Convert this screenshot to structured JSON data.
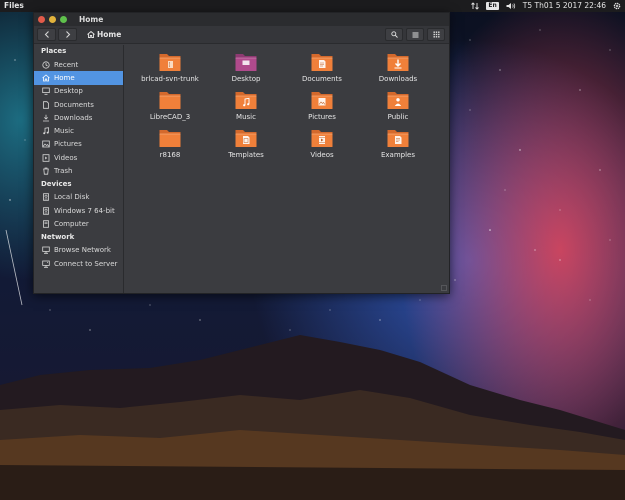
{
  "top_panel": {
    "app_name": "Files",
    "keyboard_layout": "En",
    "clock": "T5 Th01  5 2017 22:46"
  },
  "window": {
    "title": "Home",
    "path_label": "Home"
  },
  "sidebar": {
    "places_header": "Places",
    "places": [
      {
        "label": "Recent",
        "icon": "clock-icon"
      },
      {
        "label": "Home",
        "icon": "home-icon",
        "active": true
      },
      {
        "label": "Desktop",
        "icon": "desktop-icon"
      },
      {
        "label": "Documents",
        "icon": "document-icon"
      },
      {
        "label": "Downloads",
        "icon": "download-icon"
      },
      {
        "label": "Music",
        "icon": "music-icon"
      },
      {
        "label": "Pictures",
        "icon": "picture-icon"
      },
      {
        "label": "Videos",
        "icon": "video-icon"
      },
      {
        "label": "Trash",
        "icon": "trash-icon"
      }
    ],
    "devices_header": "Devices",
    "devices": [
      {
        "label": "Local Disk",
        "icon": "disk-icon"
      },
      {
        "label": "Windows 7 64-bit",
        "icon": "disk-icon"
      },
      {
        "label": "Computer",
        "icon": "computer-icon"
      }
    ],
    "network_header": "Network",
    "network": [
      {
        "label": "Browse Network",
        "icon": "network-icon"
      },
      {
        "label": "Connect to Server",
        "icon": "server-icon"
      }
    ]
  },
  "files": [
    {
      "label": "brlcad-svn-trunk",
      "icon": "folder-archive-icon"
    },
    {
      "label": "Desktop",
      "icon": "folder-desktop-icon"
    },
    {
      "label": "Documents",
      "icon": "folder-documents-icon"
    },
    {
      "label": "Downloads",
      "icon": "folder-downloads-icon"
    },
    {
      "label": "LibreCAD_3",
      "icon": "folder-icon"
    },
    {
      "label": "Music",
      "icon": "folder-music-icon"
    },
    {
      "label": "Pictures",
      "icon": "folder-pictures-icon"
    },
    {
      "label": "Public",
      "icon": "folder-public-icon"
    },
    {
      "label": "r8168",
      "icon": "folder-icon"
    },
    {
      "label": "Templates",
      "icon": "folder-templates-icon"
    },
    {
      "label": "Videos",
      "icon": "folder-videos-icon"
    },
    {
      "label": "Examples",
      "icon": "folder-examples-icon"
    }
  ],
  "colors": {
    "accent": "#5294e2",
    "folder": "#f0803a",
    "folder_desktop": "#b04a8c",
    "panel": "#1c1c1e",
    "window_bg": "#3b3c40"
  }
}
